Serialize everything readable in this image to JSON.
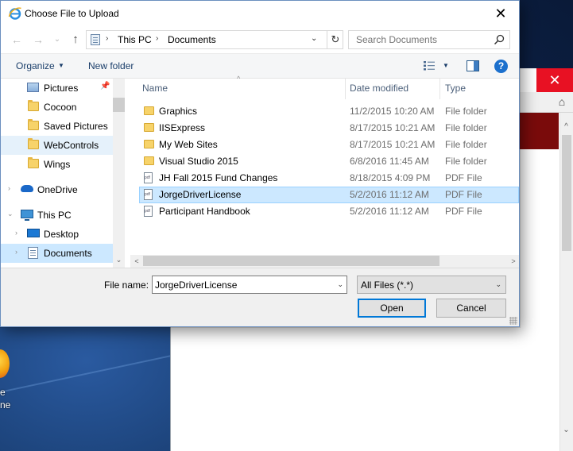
{
  "dialog": {
    "title": "Choose File to Upload",
    "close_glyph": "✕"
  },
  "nav": {
    "back_glyph": "←",
    "forward_glyph": "→",
    "recent_glyph": "⌄",
    "up_glyph": "↑",
    "breadcrumb": [
      "This PC",
      "Documents"
    ],
    "separator_glyph": "›",
    "dropdown_glyph": "⌄",
    "refresh_glyph": "↻",
    "search_placeholder": "Search Documents"
  },
  "toolbar": {
    "organize_label": "Organize",
    "new_folder_label": "New folder",
    "help_glyph": "?",
    "dropdown_glyph": "▼"
  },
  "navpane": {
    "items": [
      {
        "label": "Pictures",
        "icon": "pictures-icon",
        "pinned": true
      },
      {
        "label": "Cocoon",
        "icon": "folder-icon"
      },
      {
        "label": "Saved Pictures",
        "icon": "folder-icon"
      },
      {
        "label": "WebControls",
        "icon": "folder-icon",
        "state": "hover"
      },
      {
        "label": "Wings",
        "icon": "folder-icon"
      },
      {
        "label": "OneDrive",
        "icon": "cloud-icon"
      },
      {
        "label": "This PC",
        "icon": "computer-icon"
      },
      {
        "label": "Desktop",
        "icon": "desktop-icon"
      },
      {
        "label": "Documents",
        "icon": "documents-icon",
        "state": "current"
      }
    ],
    "pin_glyph": "📌",
    "expand_glyph": "›",
    "collapse_glyph": "⌄"
  },
  "columns": {
    "name": "Name",
    "date": "Date modified",
    "type": "Type",
    "sort_glyph": "^"
  },
  "files": [
    {
      "name": "Graphics",
      "date": "11/2/2015 10:20 AM",
      "type": "File folder",
      "kind": "folder"
    },
    {
      "name": "IISExpress",
      "date": "8/17/2015 10:21 AM",
      "type": "File folder",
      "kind": "folder"
    },
    {
      "name": "My Web Sites",
      "date": "8/17/2015 10:21 AM",
      "type": "File folder",
      "kind": "folder"
    },
    {
      "name": "Visual Studio 2015",
      "date": "6/8/2016 11:45 AM",
      "type": "File folder",
      "kind": "folder"
    },
    {
      "name": "JH Fall 2015 Fund Changes",
      "date": "8/18/2015 4:09 PM",
      "type": "PDF File",
      "kind": "pdf"
    },
    {
      "name": "JorgeDriverLicense",
      "date": "5/2/2016 11:12 AM",
      "type": "PDF File",
      "kind": "pdf",
      "selected": true
    },
    {
      "name": "Participant Handbook",
      "date": "5/2/2016 11:12 AM",
      "type": "PDF File",
      "kind": "pdf"
    }
  ],
  "footer": {
    "file_name_label": "File name:",
    "file_name_value": "JorgeDriverLicense",
    "file_type_value": "All Files (*.*)",
    "open_label": "Open",
    "cancel_label": "Cancel",
    "dropdown_glyph": "⌄"
  },
  "scroll": {
    "left_glyph": "<",
    "right_glyph": ">",
    "down_glyph": "⌄",
    "up_glyph": "^"
  },
  "browser": {
    "close_glyph": "✕",
    "home_glyph": "⌂"
  },
  "desktop": {
    "icon_label_lines": [
      "e",
      "ne"
    ]
  },
  "colors": {
    "selection": "#cce8ff",
    "accent": "#0078d7",
    "browser_close": "#e81123",
    "browser_banner": "#7a0b0b"
  }
}
